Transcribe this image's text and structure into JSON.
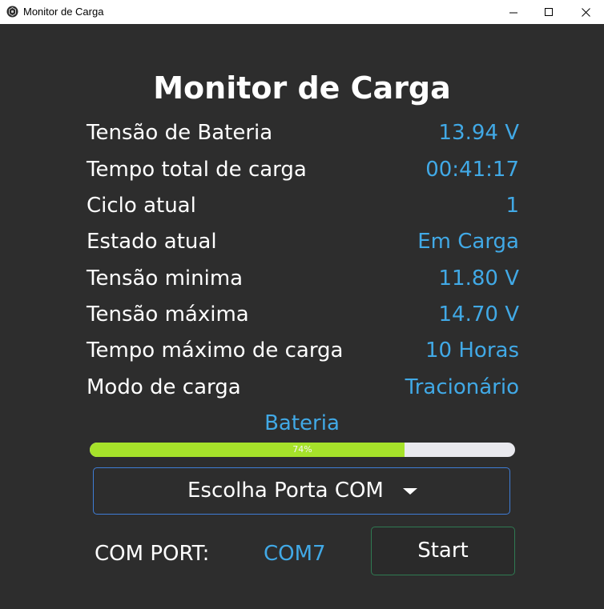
{
  "window": {
    "title": "Monitor de Carga",
    "controls": {
      "minimize_icon": "minimize-icon",
      "maximize_icon": "maximize-icon",
      "close_icon": "close-icon"
    }
  },
  "main": {
    "heading": "Monitor de Carga",
    "rows": [
      {
        "label": "Tensão de Bateria",
        "value": "13.94 V"
      },
      {
        "label": "Tempo total de carga",
        "value": "00:41:17"
      },
      {
        "label": "Ciclo atual",
        "value": "1"
      },
      {
        "label": "Estado atual",
        "value": "Em Carga"
      },
      {
        "label": "Tensão minima",
        "value": "11.80 V"
      },
      {
        "label": "Tensão máxima",
        "value": "14.70 V"
      },
      {
        "label": "Tempo máximo de carga",
        "value": "10 Horas"
      },
      {
        "label": "Modo de carga",
        "value": "Tracionário"
      }
    ],
    "battery": {
      "label": "Bateria",
      "progress_percent": 74,
      "progress_text": "74%"
    },
    "port_select": {
      "label": "Escolha Porta COM",
      "icon": "caret-down-icon"
    },
    "com_port": {
      "label": "COM PORT:",
      "value": "COM7"
    },
    "start_label": "Start"
  },
  "colors": {
    "background": "#2d2d2d",
    "value_text": "#41a9e6",
    "progress_fill": "#a6e22a",
    "select_border": "#3f7dd6",
    "button_border": "#2f7a52"
  }
}
